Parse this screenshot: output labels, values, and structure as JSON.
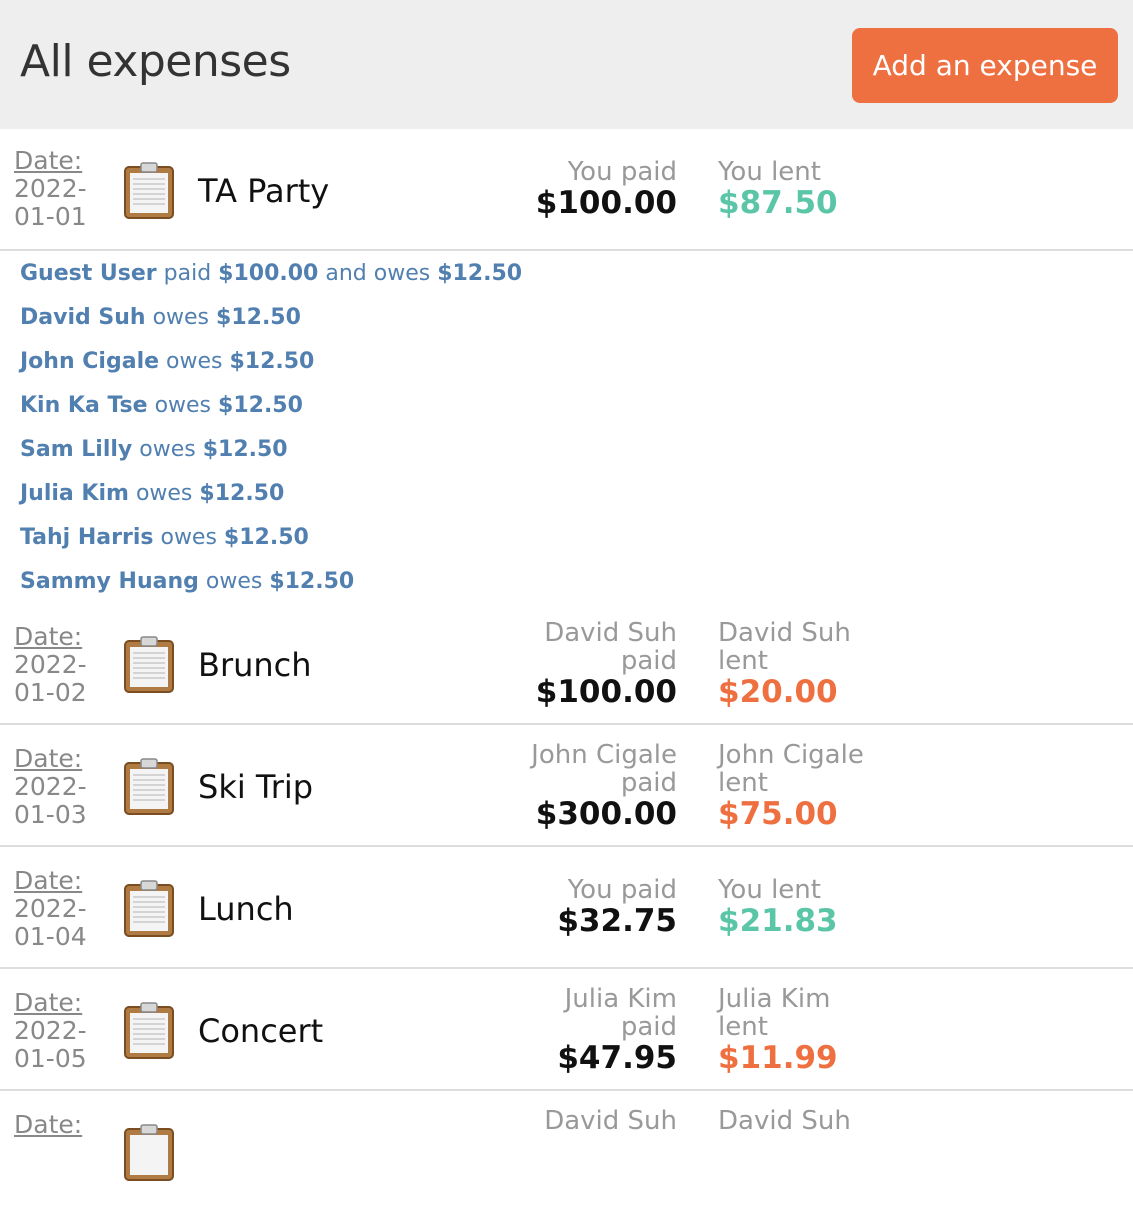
{
  "header": {
    "title": "All expenses",
    "add_button": "Add an expense"
  },
  "expenses": [
    {
      "date_label": "Date:",
      "date_line1": "2022-",
      "date_line2": "01-01",
      "description": "TA Party",
      "paid_label_line1": "You paid",
      "paid_label_line2": "",
      "paid_amount": "$100.00",
      "lent_label_line1": "You lent",
      "lent_label_line2": "",
      "lent_amount": "$87.50",
      "lent_color": "green",
      "details": [
        {
          "name": "Guest User",
          "mid": " paid ",
          "paid": "$100.00",
          "mid2": " and owes ",
          "owes": "$12.50"
        },
        {
          "name": "David Suh",
          "mid": " owes ",
          "owes": "$12.50"
        },
        {
          "name": "John Cigale",
          "mid": " owes ",
          "owes": "$12.50"
        },
        {
          "name": "Kin Ka Tse",
          "mid": " owes ",
          "owes": "$12.50"
        },
        {
          "name": "Sam Lilly",
          "mid": " owes ",
          "owes": "$12.50"
        },
        {
          "name": "Julia Kim",
          "mid": " owes ",
          "owes": "$12.50"
        },
        {
          "name": "Tahj Harris",
          "mid": " owes ",
          "owes": "$12.50"
        },
        {
          "name": "Sammy Huang",
          "mid": " owes ",
          "owes": "$12.50"
        }
      ]
    },
    {
      "date_label": "Date:",
      "date_line1": "2022-",
      "date_line2": "01-02",
      "description": "Brunch",
      "paid_label_line1": "David Suh",
      "paid_label_line2": "paid",
      "paid_amount": "$100.00",
      "lent_label_line1": "David Suh",
      "lent_label_line2": "lent",
      "lent_amount": "$20.00",
      "lent_color": "orange"
    },
    {
      "date_label": "Date:",
      "date_line1": "2022-",
      "date_line2": "01-03",
      "description": "Ski Trip",
      "paid_label_line1": "John Cigale",
      "paid_label_line2": "paid",
      "paid_amount": "$300.00",
      "lent_label_line1": "John Cigale",
      "lent_label_line2": "lent",
      "lent_amount": "$75.00",
      "lent_color": "orange"
    },
    {
      "date_label": "Date:",
      "date_line1": "2022-",
      "date_line2": "01-04",
      "description": "Lunch",
      "paid_label_line1": "You paid",
      "paid_label_line2": "",
      "paid_amount": "$32.75",
      "lent_label_line1": "You lent",
      "lent_label_line2": "",
      "lent_amount": "$21.83",
      "lent_color": "green"
    },
    {
      "date_label": "Date:",
      "date_line1": "2022-",
      "date_line2": "01-05",
      "description": "Concert",
      "paid_label_line1": "Julia Kim",
      "paid_label_line2": "paid",
      "paid_amount": "$47.95",
      "lent_label_line1": "Julia Kim",
      "lent_label_line2": "lent",
      "lent_amount": "$11.99",
      "lent_color": "orange"
    },
    {
      "date_label": "Date:",
      "paid_label_line1": "David Suh",
      "lent_label_line1": "David Suh"
    }
  ],
  "colors": {
    "accent": "#ee7040",
    "green": "#5bc5a7",
    "link_blue": "#5180b0"
  },
  "icons": {
    "expense": "clipboard-icon"
  }
}
